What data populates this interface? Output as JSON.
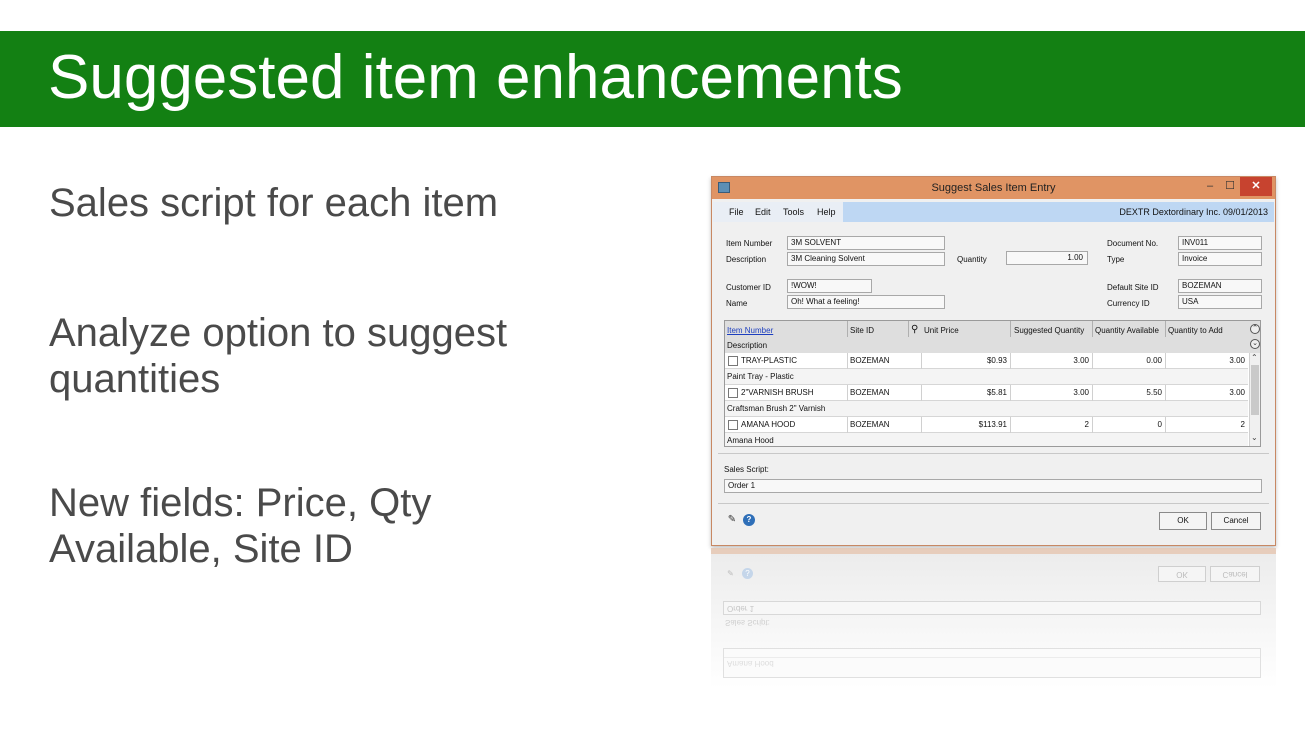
{
  "slide": {
    "title": "Suggested item enhancements",
    "bullets": [
      "Sales script for each item",
      "Analyze option to suggest quantities",
      "New fields: Price, Qty Available, Site ID"
    ],
    "colors": {
      "title_bar": "#138013",
      "bullet_text": "#4a4a4a"
    }
  },
  "window": {
    "title": "Suggest Sales Item Entry",
    "controls": {
      "minimize": "–",
      "maximize": "☐",
      "close": "✕"
    },
    "menu": [
      "File",
      "Edit",
      "Tools",
      "Help"
    ],
    "company_info": "DEXTR  Dextordinary Inc.  09/01/2013",
    "header": {
      "item_number_label": "Item Number",
      "item_number": "3M SOLVENT",
      "description_label": "Description",
      "description": "3M Cleaning Solvent",
      "quantity_label": "Quantity",
      "quantity": "1.00",
      "document_no_label": "Document No.",
      "document_no": "INV011",
      "type_label": "Type",
      "type": "Invoice",
      "customer_id_label": "Customer ID",
      "customer_id": "!WOW!",
      "name_label": "Name",
      "name": "Oh! What a feeling!",
      "default_site_label": "Default Site ID",
      "default_site": "BOZEMAN",
      "currency_label": "Currency ID",
      "currency": "USA"
    },
    "grid": {
      "columns": [
        "Item Number",
        "Site ID",
        "Unit Price",
        "Suggested Quantity",
        "Quantity Available",
        "Quantity to Add"
      ],
      "description_header": "Description",
      "rows": [
        {
          "item": "TRAY-PLASTIC",
          "site": "BOZEMAN",
          "price": "$0.93",
          "suggested": "3.00",
          "available": "0.00",
          "to_add": "3.00",
          "description": "Paint Tray - Plastic"
        },
        {
          "item": "2\"VARNISH BRUSH",
          "site": "BOZEMAN",
          "price": "$5.81",
          "suggested": "3.00",
          "available": "5.50",
          "to_add": "3.00",
          "description": "Craftsman Brush 2\" Varnish"
        },
        {
          "item": "AMANA HOOD",
          "site": "BOZEMAN",
          "price": "$113.91",
          "suggested": "2",
          "available": "0",
          "to_add": "2",
          "description": "Amana Hood"
        }
      ]
    },
    "sales_script_label": "Sales Script:",
    "sales_script": "Order 1",
    "buttons": {
      "ok": "OK",
      "cancel": "Cancel"
    },
    "icons": [
      "note-icon",
      "help-icon",
      "search-icon"
    ]
  }
}
